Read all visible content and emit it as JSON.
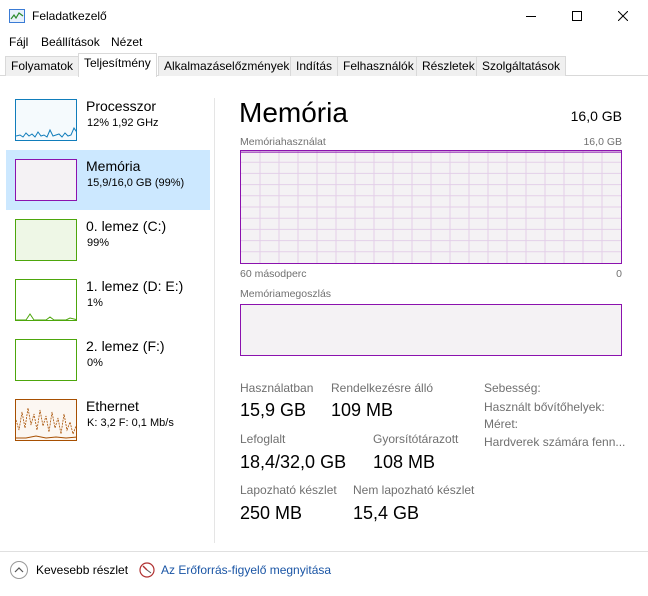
{
  "window": {
    "title": "Feladatkezelő",
    "controls": {
      "minimize": "minimize-icon",
      "maximize": "maximize-icon",
      "close": "close-icon"
    }
  },
  "menu": [
    "Fájl",
    "Beállítások",
    "Nézet"
  ],
  "tabs": [
    "Folyamatok",
    "Teljesítmény",
    "Alkalmazáselőzmények",
    "Indítás",
    "Felhasználók",
    "Részletek",
    "Szolgáltatások"
  ],
  "active_tab": "Teljesítmény",
  "sidebar": [
    {
      "name": "Processzor",
      "sub": "12%  1,92 GHz",
      "color": "#117dbb"
    },
    {
      "name": "Memória",
      "sub": "15,9/16,0 GB (99%)",
      "color": "#8b12ae"
    },
    {
      "name": "0. lemez (C:)",
      "sub": "99%",
      "color": "#4da60c"
    },
    {
      "name": "1. lemez (D: E:)",
      "sub": "1%",
      "color": "#4da60c"
    },
    {
      "name": "2. lemez (F:)",
      "sub": "0%",
      "color": "#4da60c"
    },
    {
      "name": "Ethernet",
      "sub": "K: 3,2  F: 0,1 Mb/s",
      "color": "#a74f01"
    }
  ],
  "active_sidebar": "Memória",
  "main": {
    "title": "Memória",
    "total": "16,0 GB",
    "usage_label": "Memóriahasználat",
    "usage_max": "16,0 GB",
    "usage_fill": 0.99,
    "time_label": "60 másodperc",
    "time_end": "0",
    "composition_label": "Memóriamegoszlás",
    "composition_fill": 1.0
  },
  "stats": {
    "in_use_label": "Használatban",
    "in_use": "15,9 GB",
    "available_label": "Rendelkezésre álló",
    "available": "109 MB",
    "committed_label": "Lefoglalt",
    "committed": "18,4/32,0 GB",
    "cached_label": "Gyorsítótárazott",
    "cached": "108 MB",
    "paged_label": "Lapozható készlet",
    "paged": "250 MB",
    "nonpaged_label": "Nem lapozható készlet",
    "nonpaged": "15,4 GB",
    "speed_label": "Sebesség:",
    "slots_label": "Használt bővítőhelyek:",
    "form_label": "Méret:",
    "reserved_label": "Hardverek számára fenn..."
  },
  "footer": {
    "fewer_details": "Kevesebb részlet",
    "open_monitor": "Az Erőforrás-figyelő megnyitása"
  }
}
